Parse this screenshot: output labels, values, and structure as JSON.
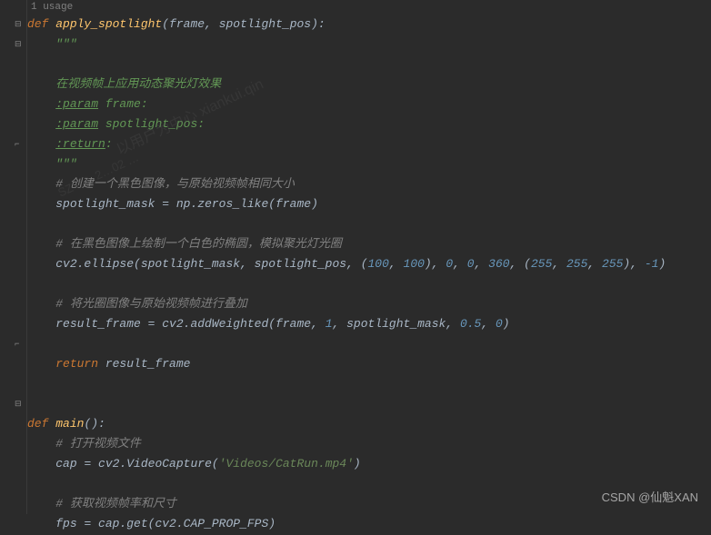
{
  "usages_hint": "1 usage",
  "watermark_main": "以用户为中心   xiankui.qin",
  "watermark_sub": "SZ-0… 2…02 …",
  "watermark_bottom": "CSDN @仙魁XAN",
  "code": {
    "l01_kw": "def ",
    "l01_fn": "apply_spotlight",
    "l01_open": "(",
    "l01_p1": "frame",
    "l01_c1": ", ",
    "l01_p2": "spotlight_pos",
    "l01_close": "):",
    "l02_doc": "\"\"\"",
    "l03_doc": "在视频帧上应用动态聚光灯效果",
    "l04_tag": ":param",
    "l04_rest": " frame:",
    "l05_tag": ":param",
    "l05_rest": " spotlight_pos:",
    "l06_tag": ":return",
    "l06_rest": ":",
    "l07_doc": "\"\"\"",
    "l08_cmt": "# 创建一个黑色图像，与原始视频帧相同大小",
    "l09_a": "spotlight_mask ",
    "l09_eq": "= ",
    "l09_b": "np.zeros_like(frame)",
    "l10_cmt": "# 在黑色图像上绘制一个白色的椭圆，模拟聚光灯光圈",
    "l11_a": "cv2.ellipse(spotlight_mask",
    "l11_c1": ", ",
    "l11_b": "spotlight_pos",
    "l11_c2": ", (",
    "l11_n1": "100",
    "l11_c3": ", ",
    "l11_n2": "100",
    "l11_c4": "), ",
    "l11_n3": "0",
    "l11_c5": ", ",
    "l11_n4": "0",
    "l11_c6": ", ",
    "l11_n5": "360",
    "l11_c7": ", (",
    "l11_n6": "255",
    "l11_c8": ", ",
    "l11_n7": "255",
    "l11_c9": ", ",
    "l11_n8": "255",
    "l11_c10": "), ",
    "l11_n9": "-1",
    "l11_c11": ")",
    "l12_cmt": "# 将光圈图像与原始视频帧进行叠加",
    "l13_a": "result_frame ",
    "l13_eq": "= ",
    "l13_b": "cv2.addWeighted(frame",
    "l13_c1": ", ",
    "l13_n1": "1",
    "l13_c2": ", ",
    "l13_d": "spotlight_mask",
    "l13_c3": ", ",
    "l13_n2": "0.5",
    "l13_c4": ", ",
    "l13_n3": "0",
    "l13_c5": ")",
    "l14_kw": "return ",
    "l14_v": "result_frame",
    "l15_kw": "def ",
    "l15_fn": "main",
    "l15_rest": "():",
    "l16_cmt": "# 打开视频文件",
    "l17_a": "cap ",
    "l17_eq": "= ",
    "l17_b": "cv2.VideoCapture(",
    "l17_str": "'Videos/CatRun.mp4'",
    "l17_c": ")",
    "l18_cmt": "# 获取视频帧率和尺寸",
    "l19_a": "fps ",
    "l19_eq": "= ",
    "l19_b": "cap.get(cv2.CAP_PROP_FPS)"
  }
}
